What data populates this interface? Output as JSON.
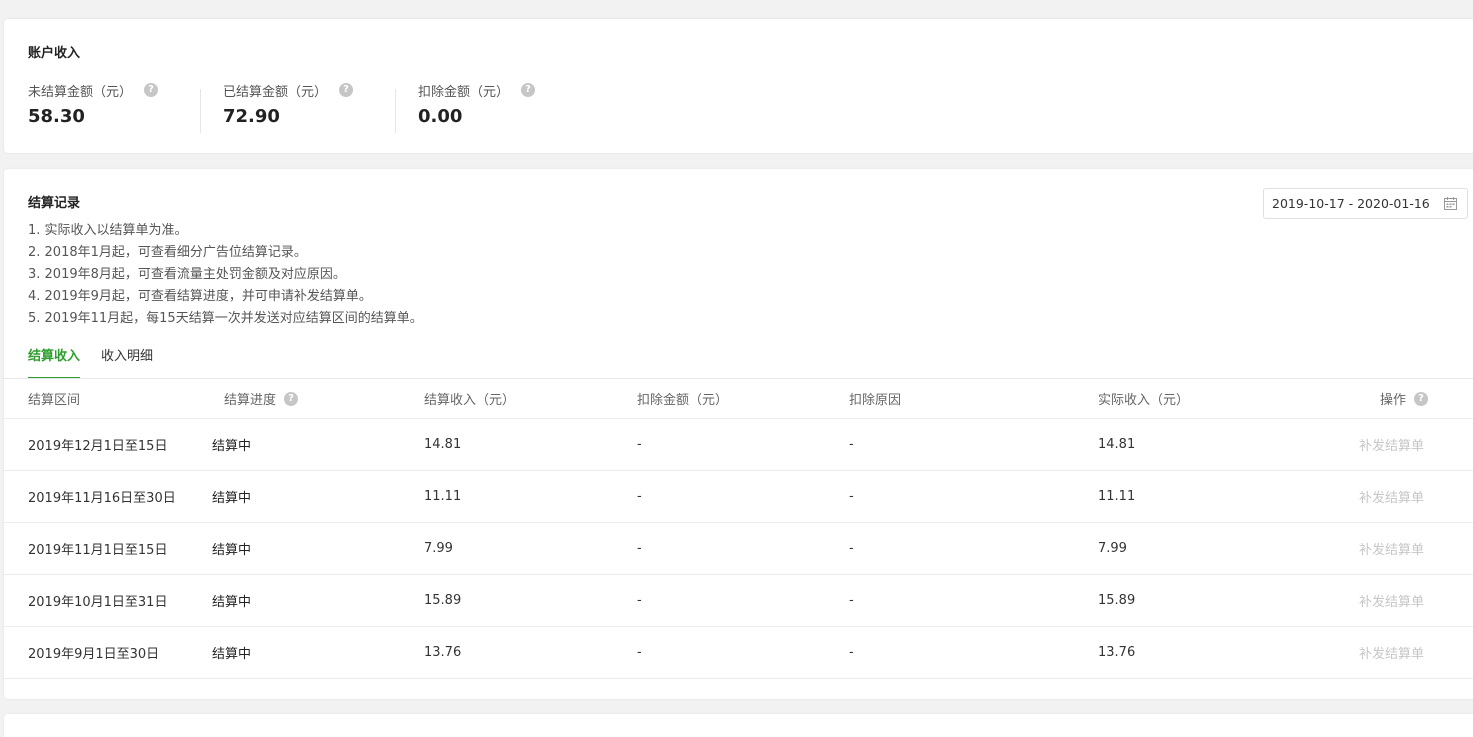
{
  "account": {
    "title": "账户收入",
    "stats": [
      {
        "label": "未结算金额（元）",
        "value": "58.30"
      },
      {
        "label": "已结算金额（元）",
        "value": "72.90"
      },
      {
        "label": "扣除金额（元）",
        "value": "0.00"
      }
    ]
  },
  "records": {
    "title": "结算记录",
    "date_range": "2019-10-17 - 2020-01-16",
    "notes": [
      "1. 实际收入以结算单为准。",
      "2. 2018年1月起，可查看细分广告位结算记录。",
      "3. 2019年8月起，可查看流量主处罚金额及对应原因。",
      "4. 2019年9月起，可查看结算进度，并可申请补发结算单。",
      "5. 2019年11月起，每15天结算一次并发送对应结算区间的结算单。"
    ],
    "tabs": [
      {
        "label": "结算收入",
        "active": true
      },
      {
        "label": "收入明细",
        "active": false
      }
    ],
    "columns": [
      "结算区间",
      "结算进度",
      "结算收入（元）",
      "扣除金额（元）",
      "扣除原因",
      "实际收入（元）",
      "操作"
    ],
    "rows": [
      {
        "period": "2019年12月1日至15日",
        "status": "结算中",
        "income": "14.81",
        "deduction": "-",
        "reason": "-",
        "actual": "14.81",
        "action": "补发结算单"
      },
      {
        "period": "2019年11月16日至30日",
        "status": "结算中",
        "income": "11.11",
        "deduction": "-",
        "reason": "-",
        "actual": "11.11",
        "action": "补发结算单"
      },
      {
        "period": "2019年11月1日至15日",
        "status": "结算中",
        "income": "7.99",
        "deduction": "-",
        "reason": "-",
        "actual": "7.99",
        "action": "补发结算单"
      },
      {
        "period": "2019年10月1日至31日",
        "status": "结算中",
        "income": "15.89",
        "deduction": "-",
        "reason": "-",
        "actual": "15.89",
        "action": "补发结算单"
      },
      {
        "period": "2019年9月1日至30日",
        "status": "结算中",
        "income": "13.76",
        "deduction": "-",
        "reason": "-",
        "actual": "13.76",
        "action": "补发结算单"
      }
    ]
  },
  "colors": {
    "accent": "#2e9e2e",
    "disabled_text": "#c7c7c7",
    "background": "#f2f2f2"
  },
  "icons": {
    "help": "question-circle-icon",
    "calendar": "calendar-icon"
  }
}
